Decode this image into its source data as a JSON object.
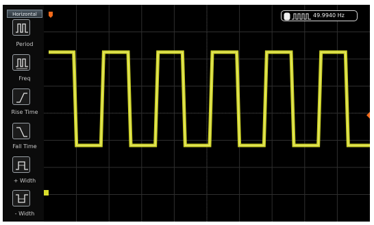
{
  "menu": {
    "header": "Horizontal",
    "items": [
      {
        "label": "Period",
        "icon": "period-icon"
      },
      {
        "label": "Freq",
        "icon": "frequency-icon"
      },
      {
        "label": "Rise Time",
        "icon": "rise-time-icon"
      },
      {
        "label": "Fall Time",
        "icon": "fall-time-icon"
      },
      {
        "label": "+ Width",
        "icon": "positive-width-icon"
      },
      {
        "label": "- Width",
        "icon": "negative-width-icon"
      }
    ]
  },
  "readout": {
    "frequency": "49.9940 Hz",
    "icon": "square-wave-icon"
  },
  "colors": {
    "trace": "#d9de2c",
    "trigger_marker": "#f26a1b",
    "ground_marker": "#d9de2c",
    "grid": "#2f2f2f",
    "background": "#000000"
  },
  "markers": {
    "trigger_position": "trigger-position-marker",
    "ground": "channel-1-ground-marker",
    "trigger_level": "trigger-level-marker"
  },
  "waveform": {
    "type": "square",
    "cycles_visible": 6
  }
}
